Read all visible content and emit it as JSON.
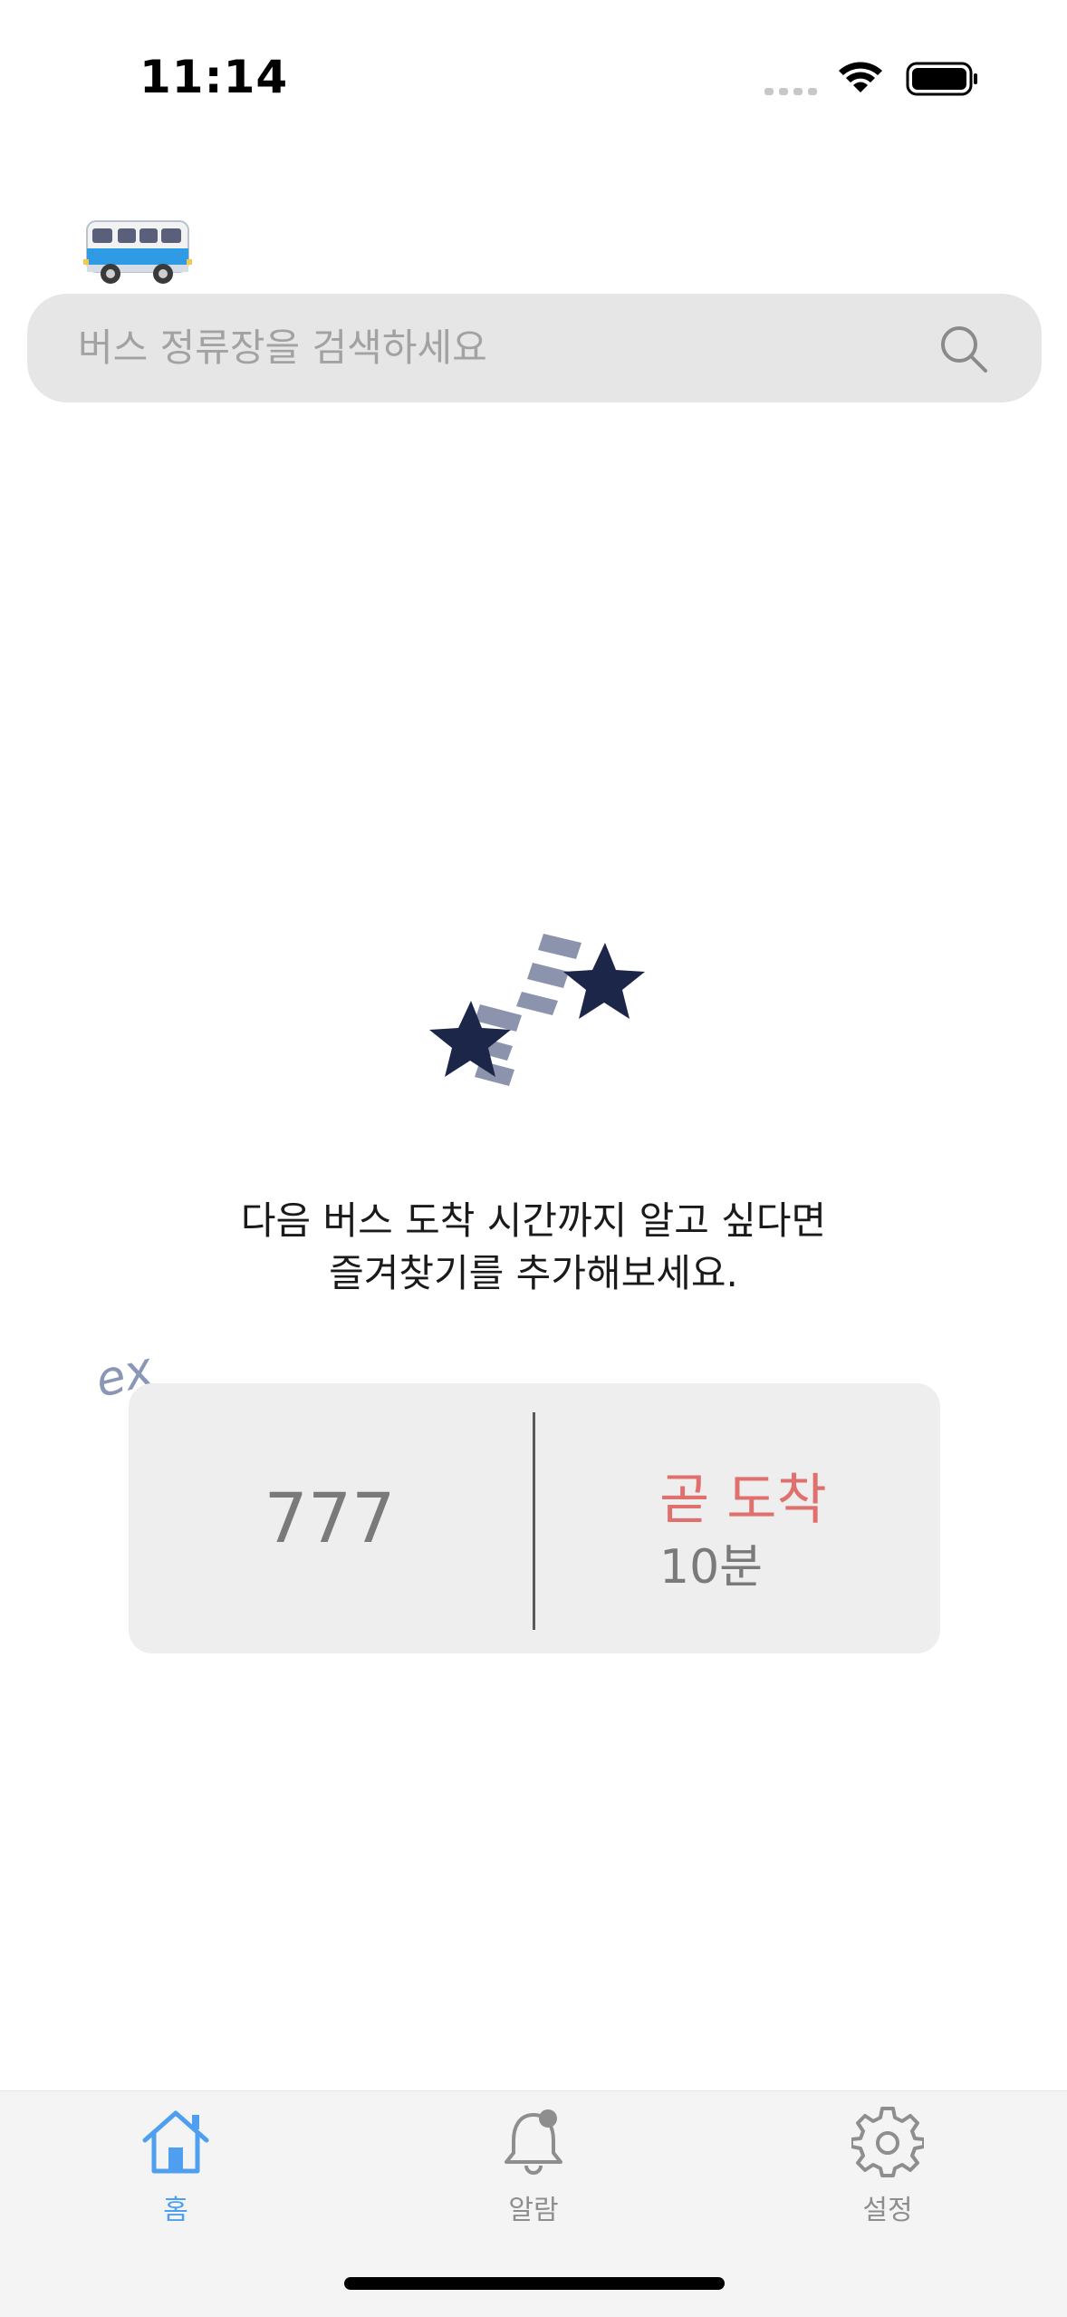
{
  "status_bar": {
    "time": "11:14"
  },
  "header": {
    "logo_icon": "bus-icon"
  },
  "search": {
    "placeholder": "버스 정류장을 검색하세요",
    "icon": "search-icon"
  },
  "empty_state": {
    "illustration": "shooting-stars-icon",
    "message_line1": "다음 버스 도착 시간까지 알고 싶다면",
    "message_line2": "즐겨찾기를 추가해보세요."
  },
  "example_card": {
    "tag": "ex",
    "route": "777",
    "status": "곧 도착",
    "time": "10분"
  },
  "tab_bar": {
    "items": [
      {
        "label": "홈",
        "icon": "home-icon",
        "active": true
      },
      {
        "label": "알람",
        "icon": "bell-icon",
        "active": false
      },
      {
        "label": "설정",
        "icon": "gear-icon",
        "active": false
      }
    ]
  },
  "colors": {
    "accent": "#4e9ff0",
    "arrival_soon": "#e0706e",
    "star_dark": "#1c2649",
    "star_light": "#8c93ac"
  }
}
